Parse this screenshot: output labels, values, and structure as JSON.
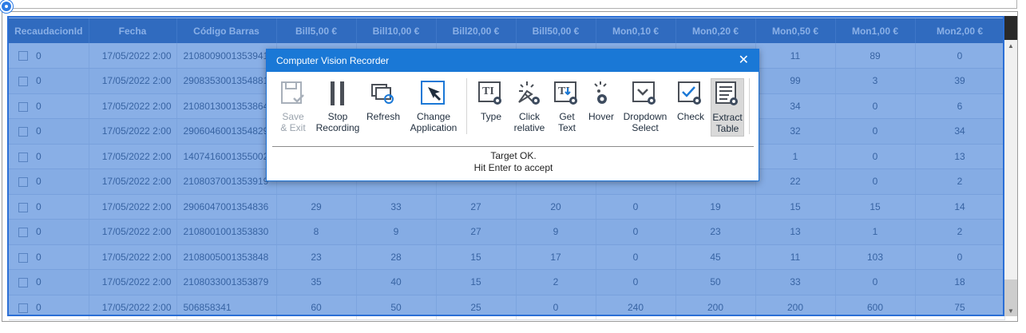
{
  "app": {
    "dialog_title": "Computer Vision Recorder"
  },
  "toolbar": {
    "items": [
      {
        "label_line1": "Save",
        "label_line2": "& Exit",
        "icon": "save-exit-icon",
        "disabled": true
      },
      {
        "label_line1": "Stop",
        "label_line2": "Recording",
        "icon": "pause-icon"
      },
      {
        "label_line1": "Refresh",
        "label_line2": "",
        "icon": "refresh-icon"
      },
      {
        "label_line1": "Change",
        "label_line2": "Application",
        "icon": "cursor-select-icon"
      },
      {
        "label_line1": "Type",
        "label_line2": "",
        "icon": "type-text-icon"
      },
      {
        "label_line1": "Click",
        "label_line2": "relative",
        "icon": "click-relative-icon"
      },
      {
        "label_line1": "Get",
        "label_line2": "Text",
        "icon": "get-text-icon"
      },
      {
        "label_line1": "Hover",
        "label_line2": "",
        "icon": "hover-icon"
      },
      {
        "label_line1": "Dropdown",
        "label_line2": "Select",
        "icon": "dropdown-select-icon"
      },
      {
        "label_line1": "Check",
        "label_line2": "",
        "icon": "check-icon"
      },
      {
        "label_line1": "Extract",
        "label_line2": "Table",
        "icon": "extract-table-icon",
        "active": true
      }
    ]
  },
  "status": {
    "line1": "Target OK.",
    "line2": "Hit Enter to accept"
  },
  "table": {
    "columns": [
      "RecaudacionId",
      "Fecha",
      "Código Barras",
      "Bill5,00 €",
      "Bill10,00 €",
      "Bill20,00 €",
      "Bill50,00 €",
      "Mon0,10 €",
      "Mon0,20 €",
      "Mon0,50 €",
      "Mon1,00 €",
      "Mon2,00 €"
    ],
    "rows": [
      [
        "0",
        "17/05/2022 2:00",
        "2108009001353941",
        "",
        "",
        "",
        "",
        "",
        "",
        "11",
        "89",
        "0"
      ],
      [
        "0",
        "17/05/2022 2:00",
        "2908353001354881",
        "",
        "",
        "",
        "",
        "",
        "",
        "99",
        "3",
        "39"
      ],
      [
        "0",
        "17/05/2022 2:00",
        "2108013001353864",
        "",
        "",
        "",
        "",
        "",
        "",
        "34",
        "0",
        "6"
      ],
      [
        "0",
        "17/05/2022 2:00",
        "2906046001354829",
        "",
        "",
        "",
        "",
        "",
        "",
        "32",
        "0",
        "34"
      ],
      [
        "0",
        "17/05/2022 2:00",
        "1407416001355002",
        "",
        "",
        "",
        "",
        "",
        "",
        "1",
        "0",
        "13"
      ],
      [
        "0",
        "17/05/2022 2:00",
        "2108037001353919",
        "",
        "",
        "",
        "",
        "",
        "",
        "22",
        "0",
        "2"
      ],
      [
        "0",
        "17/05/2022 2:00",
        "2906047001354836",
        "29",
        "33",
        "27",
        "20",
        "0",
        "19",
        "15",
        "15",
        "14"
      ],
      [
        "0",
        "17/05/2022 2:00",
        "2108001001353830",
        "8",
        "9",
        "27",
        "9",
        "0",
        "23",
        "13",
        "1",
        "2"
      ],
      [
        "0",
        "17/05/2022 2:00",
        "2108005001353848",
        "23",
        "28",
        "15",
        "17",
        "0",
        "45",
        "11",
        "103",
        "0"
      ],
      [
        "0",
        "17/05/2022 2:00",
        "2108033001353879",
        "35",
        "40",
        "15",
        "2",
        "0",
        "50",
        "33",
        "0",
        "18"
      ],
      [
        "0",
        "17/05/2022 2:00",
        "506858341",
        "60",
        "50",
        "25",
        "0",
        "240",
        "200",
        "200",
        "600",
        "75"
      ]
    ]
  },
  "colors": {
    "header_bg": "#2c5da3",
    "selection_overlay": "#3476d4",
    "dialog_titlebar": "#1a78d6"
  }
}
